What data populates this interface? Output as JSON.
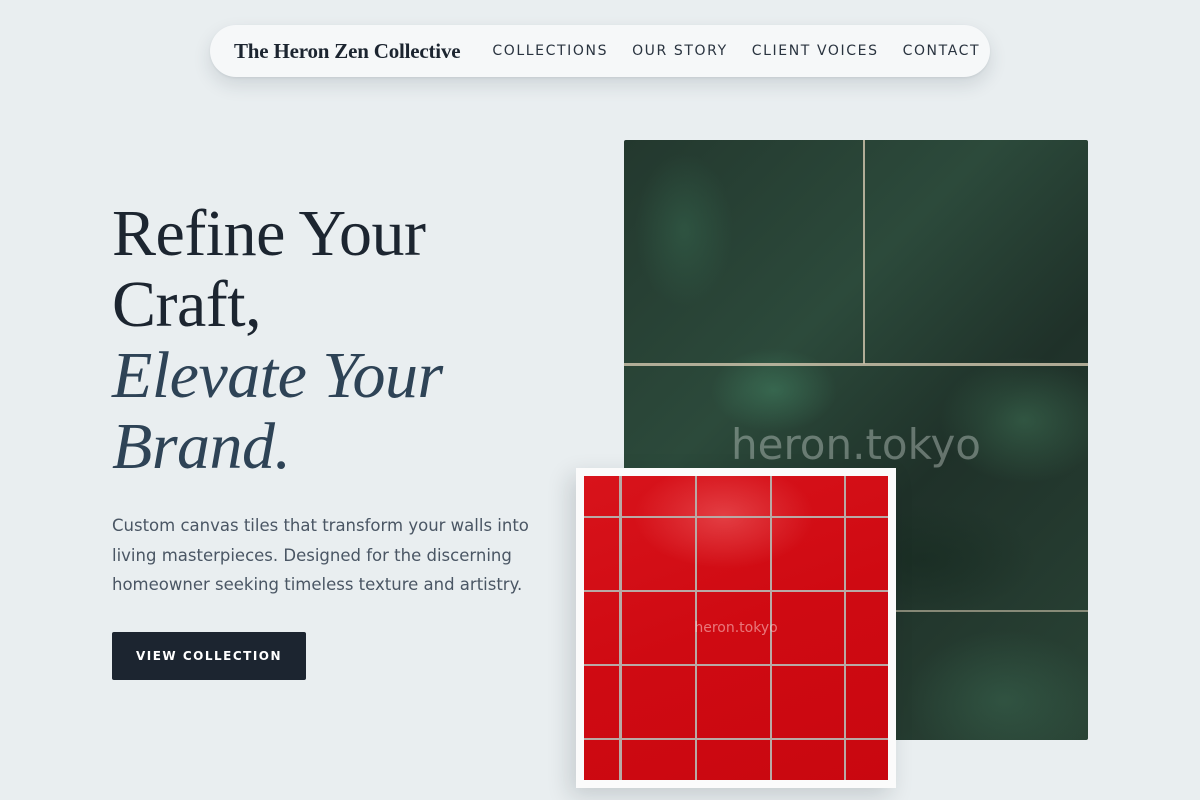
{
  "nav": {
    "brand": "The Heron Zen Collective",
    "links": [
      "COLLECTIONS",
      "OUR STORY",
      "CLIENT VOICES",
      "CONTACT"
    ]
  },
  "hero": {
    "title_line1": "Refine Your Craft,",
    "title_line2": "Elevate Your Brand.",
    "description": "Custom canvas tiles that transform your walls into living masterpieces. Designed for the discerning homeowner seeking timeless texture and artistry.",
    "cta_label": "VIEW COLLECTION"
  },
  "images": {
    "green_tile": {
      "watermark": "heron.tokyo"
    },
    "red_tile": {
      "watermark": "heron.tokyo"
    }
  },
  "colors": {
    "background": "#e9eef0",
    "text_dark": "#1c2530",
    "text_accent": "#2e4356",
    "button": "#1c2530"
  }
}
